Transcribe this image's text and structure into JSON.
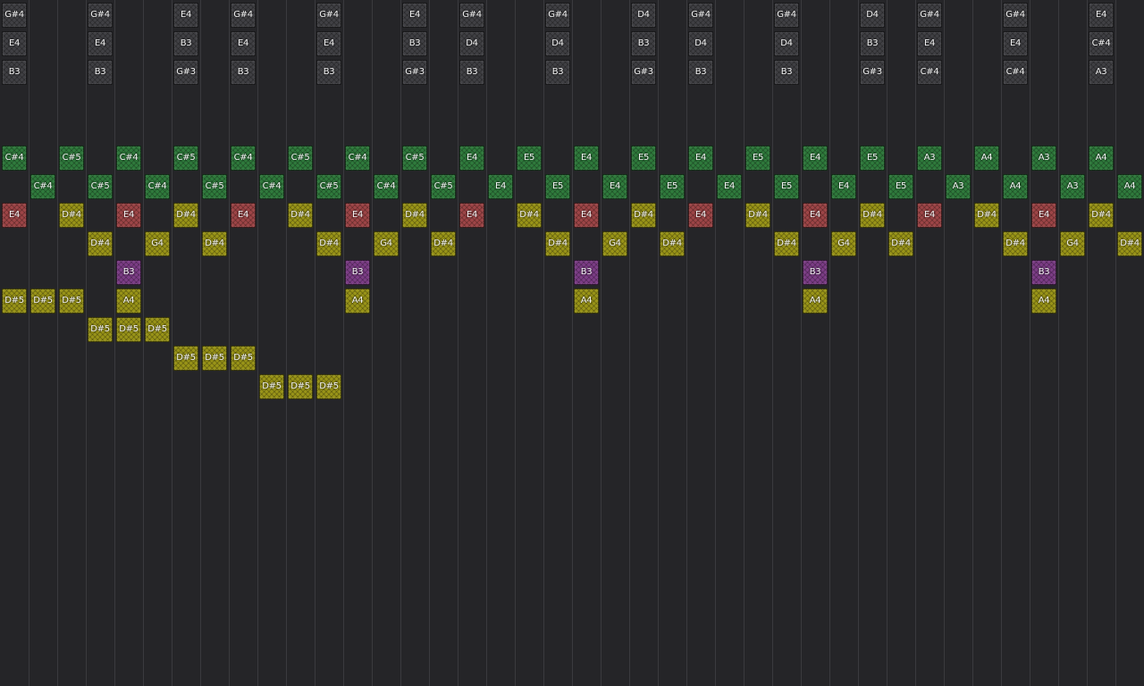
{
  "colors": {
    "background": "#252528",
    "gridline": "#3a3a3e",
    "chord": "#404044",
    "green": "#2f7a3c",
    "red": "#9d4547",
    "yellow": "#999418",
    "purple": "#7c3d86"
  },
  "columns": 40,
  "notes": [
    {
      "label": "G#4",
      "col": 0,
      "row": 0,
      "color": "chord"
    },
    {
      "label": "E4",
      "col": 0,
      "row": 1,
      "color": "chord"
    },
    {
      "label": "B3",
      "col": 0,
      "row": 2,
      "color": "chord"
    },
    {
      "label": "G#4",
      "col": 3,
      "row": 0,
      "color": "chord"
    },
    {
      "label": "E4",
      "col": 3,
      "row": 1,
      "color": "chord"
    },
    {
      "label": "B3",
      "col": 3,
      "row": 2,
      "color": "chord"
    },
    {
      "label": "E4",
      "col": 6,
      "row": 0,
      "color": "chord"
    },
    {
      "label": "B3",
      "col": 6,
      "row": 1,
      "color": "chord"
    },
    {
      "label": "G#3",
      "col": 6,
      "row": 2,
      "color": "chord"
    },
    {
      "label": "G#4",
      "col": 8,
      "row": 0,
      "color": "chord"
    },
    {
      "label": "E4",
      "col": 8,
      "row": 1,
      "color": "chord"
    },
    {
      "label": "B3",
      "col": 8,
      "row": 2,
      "color": "chord"
    },
    {
      "label": "G#4",
      "col": 11,
      "row": 0,
      "color": "chord"
    },
    {
      "label": "E4",
      "col": 11,
      "row": 1,
      "color": "chord"
    },
    {
      "label": "B3",
      "col": 11,
      "row": 2,
      "color": "chord"
    },
    {
      "label": "E4",
      "col": 14,
      "row": 0,
      "color": "chord"
    },
    {
      "label": "B3",
      "col": 14,
      "row": 1,
      "color": "chord"
    },
    {
      "label": "G#3",
      "col": 14,
      "row": 2,
      "color": "chord"
    },
    {
      "label": "G#4",
      "col": 16,
      "row": 0,
      "color": "chord"
    },
    {
      "label": "D4",
      "col": 16,
      "row": 1,
      "color": "chord"
    },
    {
      "label": "B3",
      "col": 16,
      "row": 2,
      "color": "chord"
    },
    {
      "label": "G#4",
      "col": 19,
      "row": 0,
      "color": "chord"
    },
    {
      "label": "D4",
      "col": 19,
      "row": 1,
      "color": "chord"
    },
    {
      "label": "B3",
      "col": 19,
      "row": 2,
      "color": "chord"
    },
    {
      "label": "D4",
      "col": 22,
      "row": 0,
      "color": "chord"
    },
    {
      "label": "B3",
      "col": 22,
      "row": 1,
      "color": "chord"
    },
    {
      "label": "G#3",
      "col": 22,
      "row": 2,
      "color": "chord"
    },
    {
      "label": "G#4",
      "col": 24,
      "row": 0,
      "color": "chord"
    },
    {
      "label": "D4",
      "col": 24,
      "row": 1,
      "color": "chord"
    },
    {
      "label": "B3",
      "col": 24,
      "row": 2,
      "color": "chord"
    },
    {
      "label": "G#4",
      "col": 27,
      "row": 0,
      "color": "chord"
    },
    {
      "label": "D4",
      "col": 27,
      "row": 1,
      "color": "chord"
    },
    {
      "label": "B3",
      "col": 27,
      "row": 2,
      "color": "chord"
    },
    {
      "label": "D4",
      "col": 30,
      "row": 0,
      "color": "chord"
    },
    {
      "label": "B3",
      "col": 30,
      "row": 1,
      "color": "chord"
    },
    {
      "label": "G#3",
      "col": 30,
      "row": 2,
      "color": "chord"
    },
    {
      "label": "G#4",
      "col": 32,
      "row": 0,
      "color": "chord"
    },
    {
      "label": "E4",
      "col": 32,
      "row": 1,
      "color": "chord"
    },
    {
      "label": "C#4",
      "col": 32,
      "row": 2,
      "color": "chord"
    },
    {
      "label": "G#4",
      "col": 35,
      "row": 0,
      "color": "chord"
    },
    {
      "label": "E4",
      "col": 35,
      "row": 1,
      "color": "chord"
    },
    {
      "label": "C#4",
      "col": 35,
      "row": 2,
      "color": "chord"
    },
    {
      "label": "E4",
      "col": 38,
      "row": 0,
      "color": "chord"
    },
    {
      "label": "C#4",
      "col": 38,
      "row": 1,
      "color": "chord"
    },
    {
      "label": "A3",
      "col": 38,
      "row": 2,
      "color": "chord"
    },
    {
      "label": "C#4",
      "col": 0,
      "row": 5,
      "color": "green"
    },
    {
      "label": "C#4",
      "col": 1,
      "row": 6,
      "color": "green"
    },
    {
      "label": "C#5",
      "col": 2,
      "row": 5,
      "color": "green"
    },
    {
      "label": "C#5",
      "col": 3,
      "row": 6,
      "color": "green"
    },
    {
      "label": "C#4",
      "col": 4,
      "row": 5,
      "color": "green"
    },
    {
      "label": "C#4",
      "col": 5,
      "row": 6,
      "color": "green"
    },
    {
      "label": "C#5",
      "col": 6,
      "row": 5,
      "color": "green"
    },
    {
      "label": "C#5",
      "col": 7,
      "row": 6,
      "color": "green"
    },
    {
      "label": "C#4",
      "col": 8,
      "row": 5,
      "color": "green"
    },
    {
      "label": "C#4",
      "col": 9,
      "row": 6,
      "color": "green"
    },
    {
      "label": "C#5",
      "col": 10,
      "row": 5,
      "color": "green"
    },
    {
      "label": "C#5",
      "col": 11,
      "row": 6,
      "color": "green"
    },
    {
      "label": "C#4",
      "col": 12,
      "row": 5,
      "color": "green"
    },
    {
      "label": "C#4",
      "col": 13,
      "row": 6,
      "color": "green"
    },
    {
      "label": "C#5",
      "col": 14,
      "row": 5,
      "color": "green"
    },
    {
      "label": "C#5",
      "col": 15,
      "row": 6,
      "color": "green"
    },
    {
      "label": "E4",
      "col": 16,
      "row": 5,
      "color": "green"
    },
    {
      "label": "E4",
      "col": 17,
      "row": 6,
      "color": "green"
    },
    {
      "label": "E5",
      "col": 18,
      "row": 5,
      "color": "green"
    },
    {
      "label": "E5",
      "col": 19,
      "row": 6,
      "color": "green"
    },
    {
      "label": "E4",
      "col": 20,
      "row": 5,
      "color": "green"
    },
    {
      "label": "E4",
      "col": 21,
      "row": 6,
      "color": "green"
    },
    {
      "label": "E5",
      "col": 22,
      "row": 5,
      "color": "green"
    },
    {
      "label": "E5",
      "col": 23,
      "row": 6,
      "color": "green"
    },
    {
      "label": "E4",
      "col": 24,
      "row": 5,
      "color": "green"
    },
    {
      "label": "E4",
      "col": 25,
      "row": 6,
      "color": "green"
    },
    {
      "label": "E5",
      "col": 26,
      "row": 5,
      "color": "green"
    },
    {
      "label": "E5",
      "col": 27,
      "row": 6,
      "color": "green"
    },
    {
      "label": "E4",
      "col": 28,
      "row": 5,
      "color": "green"
    },
    {
      "label": "E4",
      "col": 29,
      "row": 6,
      "color": "green"
    },
    {
      "label": "E5",
      "col": 30,
      "row": 5,
      "color": "green"
    },
    {
      "label": "E5",
      "col": 31,
      "row": 6,
      "color": "green"
    },
    {
      "label": "A3",
      "col": 32,
      "row": 5,
      "color": "green"
    },
    {
      "label": "A3",
      "col": 33,
      "row": 6,
      "color": "green"
    },
    {
      "label": "A4",
      "col": 34,
      "row": 5,
      "color": "green"
    },
    {
      "label": "A4",
      "col": 35,
      "row": 6,
      "color": "green"
    },
    {
      "label": "A3",
      "col": 36,
      "row": 5,
      "color": "green"
    },
    {
      "label": "A3",
      "col": 37,
      "row": 6,
      "color": "green"
    },
    {
      "label": "A4",
      "col": 38,
      "row": 5,
      "color": "green"
    },
    {
      "label": "A4",
      "col": 39,
      "row": 6,
      "color": "green"
    },
    {
      "label": "E4",
      "col": 0,
      "row": 7,
      "color": "red"
    },
    {
      "label": "D#4",
      "col": 2,
      "row": 7,
      "color": "yellow"
    },
    {
      "label": "D#4",
      "col": 3,
      "row": 8,
      "color": "yellow"
    },
    {
      "label": "E4",
      "col": 4,
      "row": 7,
      "color": "red"
    },
    {
      "label": "G4",
      "col": 5,
      "row": 8,
      "color": "yellow"
    },
    {
      "label": "D#4",
      "col": 6,
      "row": 7,
      "color": "yellow"
    },
    {
      "label": "D#4",
      "col": 7,
      "row": 8,
      "color": "yellow"
    },
    {
      "label": "E4",
      "col": 8,
      "row": 7,
      "color": "red"
    },
    {
      "label": "D#4",
      "col": 10,
      "row": 7,
      "color": "yellow"
    },
    {
      "label": "D#4",
      "col": 11,
      "row": 8,
      "color": "yellow"
    },
    {
      "label": "E4",
      "col": 12,
      "row": 7,
      "color": "red"
    },
    {
      "label": "G4",
      "col": 13,
      "row": 8,
      "color": "yellow"
    },
    {
      "label": "D#4",
      "col": 14,
      "row": 7,
      "color": "yellow"
    },
    {
      "label": "D#4",
      "col": 15,
      "row": 8,
      "color": "yellow"
    },
    {
      "label": "E4",
      "col": 16,
      "row": 7,
      "color": "red"
    },
    {
      "label": "D#4",
      "col": 18,
      "row": 7,
      "color": "yellow"
    },
    {
      "label": "D#4",
      "col": 19,
      "row": 8,
      "color": "yellow"
    },
    {
      "label": "E4",
      "col": 20,
      "row": 7,
      "color": "red"
    },
    {
      "label": "G4",
      "col": 21,
      "row": 8,
      "color": "yellow"
    },
    {
      "label": "D#4",
      "col": 22,
      "row": 7,
      "color": "yellow"
    },
    {
      "label": "D#4",
      "col": 23,
      "row": 8,
      "color": "yellow"
    },
    {
      "label": "E4",
      "col": 24,
      "row": 7,
      "color": "red"
    },
    {
      "label": "D#4",
      "col": 26,
      "row": 7,
      "color": "yellow"
    },
    {
      "label": "D#4",
      "col": 27,
      "row": 8,
      "color": "yellow"
    },
    {
      "label": "E4",
      "col": 28,
      "row": 7,
      "color": "red"
    },
    {
      "label": "G4",
      "col": 29,
      "row": 8,
      "color": "yellow"
    },
    {
      "label": "D#4",
      "col": 30,
      "row": 7,
      "color": "yellow"
    },
    {
      "label": "D#4",
      "col": 31,
      "row": 8,
      "color": "yellow"
    },
    {
      "label": "E4",
      "col": 32,
      "row": 7,
      "color": "red"
    },
    {
      "label": "D#4",
      "col": 34,
      "row": 7,
      "color": "yellow"
    },
    {
      "label": "D#4",
      "col": 35,
      "row": 8,
      "color": "yellow"
    },
    {
      "label": "E4",
      "col": 36,
      "row": 7,
      "color": "red"
    },
    {
      "label": "G4",
      "col": 37,
      "row": 8,
      "color": "yellow"
    },
    {
      "label": "D#4",
      "col": 38,
      "row": 7,
      "color": "yellow"
    },
    {
      "label": "D#4",
      "col": 39,
      "row": 8,
      "color": "yellow"
    },
    {
      "label": "B3",
      "col": 4,
      "row": 9,
      "color": "purple"
    },
    {
      "label": "B3",
      "col": 12,
      "row": 9,
      "color": "purple"
    },
    {
      "label": "B3",
      "col": 20,
      "row": 9,
      "color": "purple"
    },
    {
      "label": "B3",
      "col": 28,
      "row": 9,
      "color": "purple"
    },
    {
      "label": "B3",
      "col": 36,
      "row": 9,
      "color": "purple"
    },
    {
      "label": "A4",
      "col": 4,
      "row": 10,
      "color": "yellow"
    },
    {
      "label": "A4",
      "col": 12,
      "row": 10,
      "color": "yellow"
    },
    {
      "label": "A4",
      "col": 20,
      "row": 10,
      "color": "yellow"
    },
    {
      "label": "A4",
      "col": 28,
      "row": 10,
      "color": "yellow"
    },
    {
      "label": "A4",
      "col": 36,
      "row": 10,
      "color": "yellow"
    },
    {
      "label": "D#5",
      "col": 0,
      "row": 10,
      "color": "yellow"
    },
    {
      "label": "D#5",
      "col": 1,
      "row": 10,
      "color": "yellow"
    },
    {
      "label": "D#5",
      "col": 2,
      "row": 10,
      "color": "yellow"
    },
    {
      "label": "D#5",
      "col": 3,
      "row": 11,
      "color": "yellow"
    },
    {
      "label": "D#5",
      "col": 4,
      "row": 11,
      "color": "yellow"
    },
    {
      "label": "D#5",
      "col": 5,
      "row": 11,
      "color": "yellow"
    },
    {
      "label": "D#5",
      "col": 6,
      "row": 12,
      "color": "yellow"
    },
    {
      "label": "D#5",
      "col": 7,
      "row": 12,
      "color": "yellow"
    },
    {
      "label": "D#5",
      "col": 8,
      "row": 12,
      "color": "yellow"
    },
    {
      "label": "D#5",
      "col": 9,
      "row": 13,
      "color": "yellow"
    },
    {
      "label": "D#5",
      "col": 10,
      "row": 13,
      "color": "yellow"
    },
    {
      "label": "D#5",
      "col": 11,
      "row": 13,
      "color": "yellow"
    }
  ]
}
